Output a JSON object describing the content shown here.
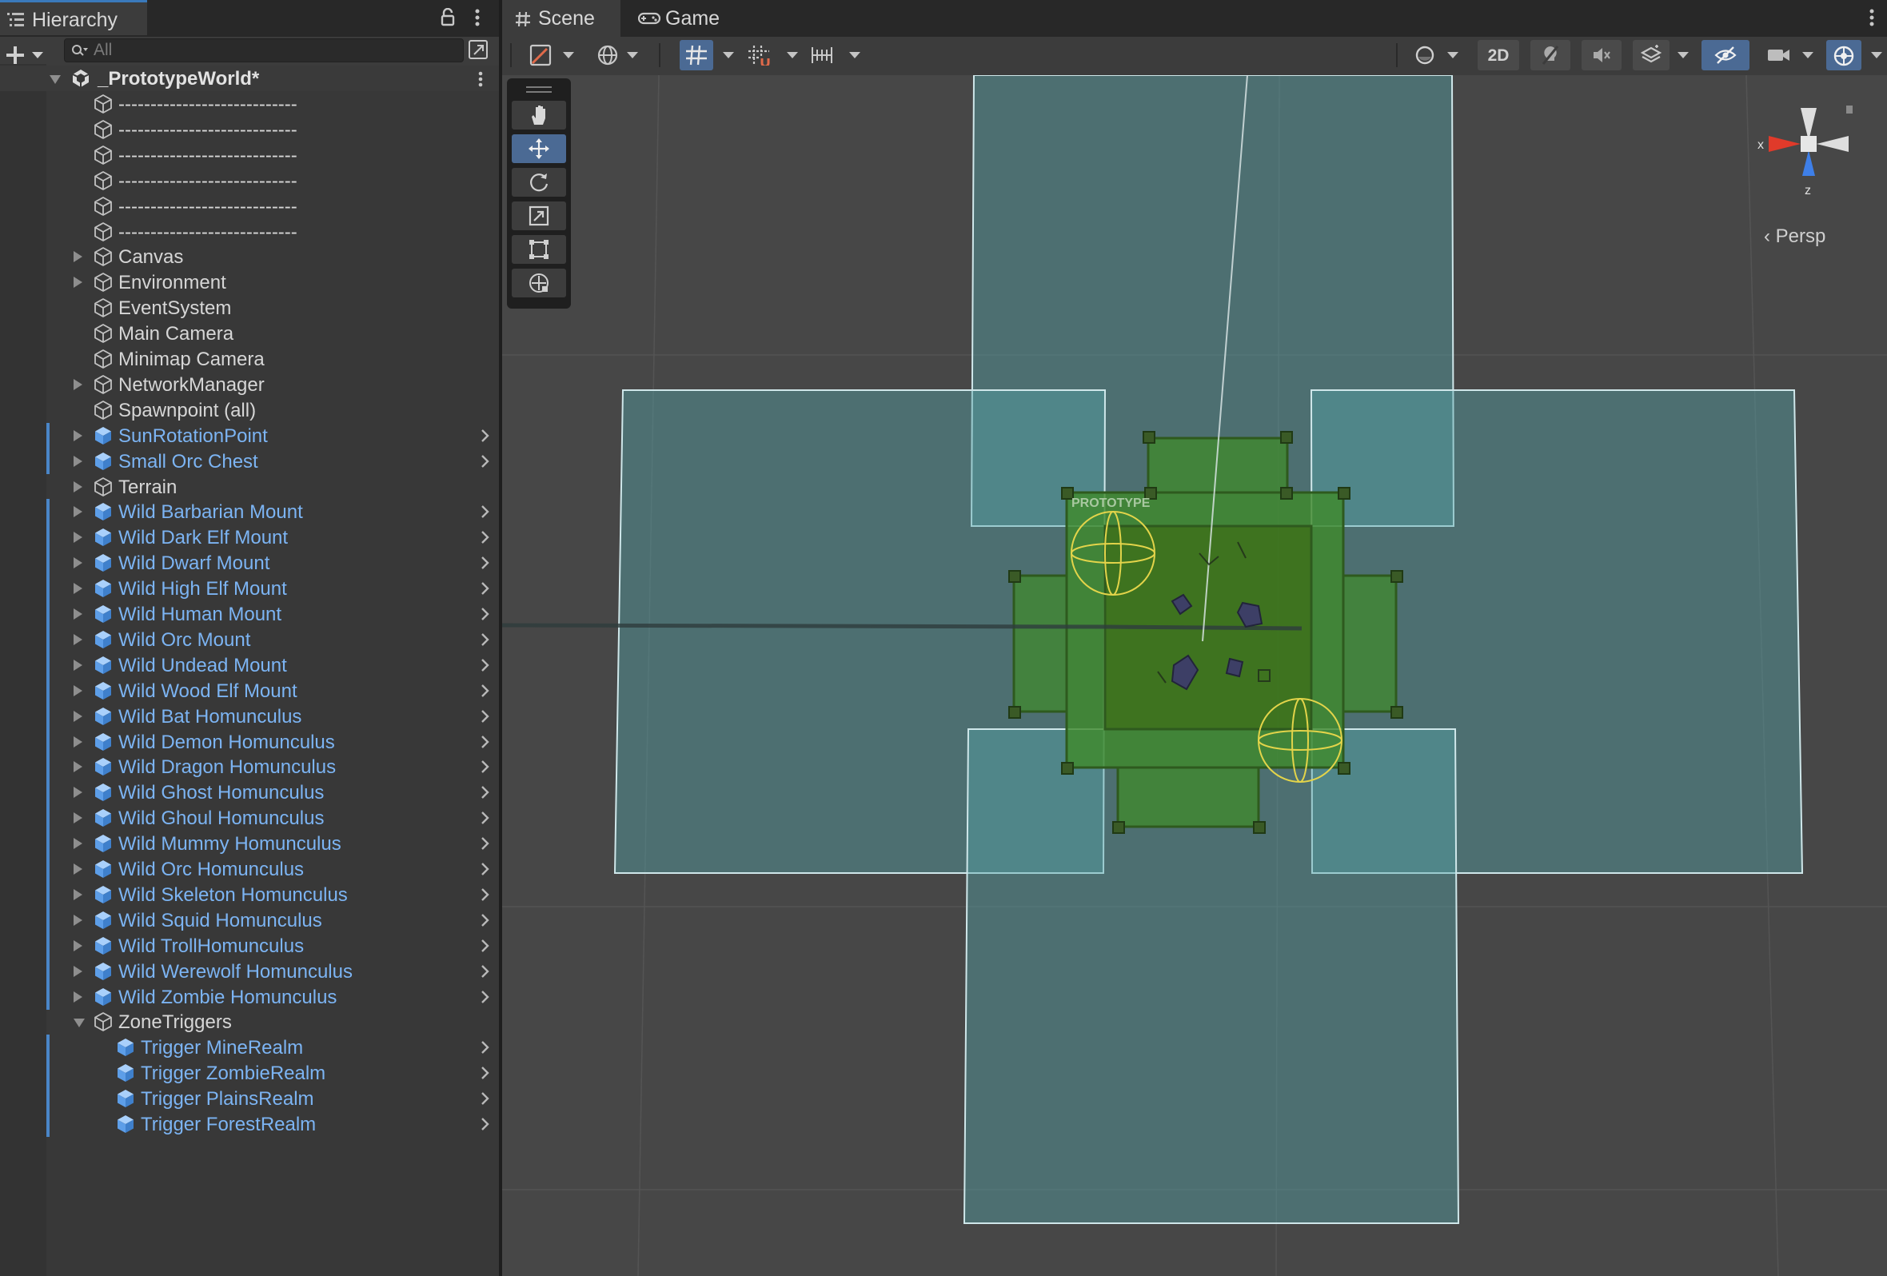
{
  "hierarchy": {
    "tab_title": "Hierarchy",
    "search_placeholder": "All",
    "scene_name": "_PrototypeWorld*",
    "rows": [
      {
        "label": "----------------------------",
        "depth": 0,
        "expander": "none",
        "prefab": false
      },
      {
        "label": "----------------------------",
        "depth": 0,
        "expander": "none",
        "prefab": false
      },
      {
        "label": "----------------------------",
        "depth": 0,
        "expander": "none",
        "prefab": false
      },
      {
        "label": "----------------------------",
        "depth": 0,
        "expander": "none",
        "prefab": false
      },
      {
        "label": "----------------------------",
        "depth": 0,
        "expander": "none",
        "prefab": false
      },
      {
        "label": "----------------------------",
        "depth": 0,
        "expander": "none",
        "prefab": false
      },
      {
        "label": "Canvas",
        "depth": 0,
        "expander": "closed",
        "prefab": false
      },
      {
        "label": "Environment",
        "depth": 0,
        "expander": "closed",
        "prefab": false
      },
      {
        "label": "EventSystem",
        "depth": 0,
        "expander": "none",
        "prefab": false
      },
      {
        "label": "Main Camera",
        "depth": 0,
        "expander": "none",
        "prefab": false
      },
      {
        "label": "Minimap Camera",
        "depth": 0,
        "expander": "none",
        "prefab": false
      },
      {
        "label": "NetworkManager",
        "depth": 0,
        "expander": "closed",
        "prefab": false
      },
      {
        "label": "Spawnpoint (all)",
        "depth": 0,
        "expander": "none",
        "prefab": false
      },
      {
        "label": "SunRotationPoint",
        "depth": 0,
        "expander": "closed",
        "prefab": true
      },
      {
        "label": "Small Orc Chest",
        "depth": 0,
        "expander": "closed",
        "prefab": true
      },
      {
        "label": "Terrain",
        "depth": 0,
        "expander": "closed",
        "prefab": false
      },
      {
        "label": "Wild Barbarian Mount",
        "depth": 0,
        "expander": "closed",
        "prefab": true
      },
      {
        "label": "Wild Dark Elf Mount",
        "depth": 0,
        "expander": "closed",
        "prefab": true
      },
      {
        "label": "Wild Dwarf Mount",
        "depth": 0,
        "expander": "closed",
        "prefab": true
      },
      {
        "label": "Wild High Elf Mount",
        "depth": 0,
        "expander": "closed",
        "prefab": true
      },
      {
        "label": "Wild Human Mount",
        "depth": 0,
        "expander": "closed",
        "prefab": true
      },
      {
        "label": "Wild Orc Mount",
        "depth": 0,
        "expander": "closed",
        "prefab": true
      },
      {
        "label": "Wild Undead Mount",
        "depth": 0,
        "expander": "closed",
        "prefab": true
      },
      {
        "label": "Wild Wood Elf Mount",
        "depth": 0,
        "expander": "closed",
        "prefab": true
      },
      {
        "label": "Wild Bat Homunculus",
        "depth": 0,
        "expander": "closed",
        "prefab": true
      },
      {
        "label": "Wild Demon Homunculus",
        "depth": 0,
        "expander": "closed",
        "prefab": true
      },
      {
        "label": "Wild Dragon Homunculus",
        "depth": 0,
        "expander": "closed",
        "prefab": true
      },
      {
        "label": "Wild Ghost Homunculus",
        "depth": 0,
        "expander": "closed",
        "prefab": true
      },
      {
        "label": "Wild Ghoul Homunculus",
        "depth": 0,
        "expander": "closed",
        "prefab": true
      },
      {
        "label": "Wild Mummy Homunculus",
        "depth": 0,
        "expander": "closed",
        "prefab": true
      },
      {
        "label": "Wild Orc Homunculus",
        "depth": 0,
        "expander": "closed",
        "prefab": true
      },
      {
        "label": "Wild Skeleton Homunculus",
        "depth": 0,
        "expander": "closed",
        "prefab": true
      },
      {
        "label": "Wild Squid Homunculus",
        "depth": 0,
        "expander": "closed",
        "prefab": true
      },
      {
        "label": "Wild TrollHomunculus",
        "depth": 0,
        "expander": "closed",
        "prefab": true
      },
      {
        "label": "Wild Werewolf Homunculus",
        "depth": 0,
        "expander": "closed",
        "prefab": true
      },
      {
        "label": "Wild Zombie Homunculus",
        "depth": 0,
        "expander": "closed",
        "prefab": true
      },
      {
        "label": "ZoneTriggers",
        "depth": 0,
        "expander": "open",
        "prefab": false
      },
      {
        "label": "Trigger MineRealm",
        "depth": 1,
        "expander": "none",
        "prefab": true
      },
      {
        "label": "Trigger ZombieRealm",
        "depth": 1,
        "expander": "none",
        "prefab": true
      },
      {
        "label": "Trigger PlainsRealm",
        "depth": 1,
        "expander": "none",
        "prefab": true
      },
      {
        "label": "Trigger ForestRealm",
        "depth": 1,
        "expander": "none",
        "prefab": true
      }
    ]
  },
  "scene_view": {
    "tab_scene": "Scene",
    "tab_game": "Game",
    "btn_2d": "2D",
    "projection_label": "Persp",
    "axis_x": "x",
    "axis_z": "z",
    "prototype_label": "PROTOTYPE"
  },
  "colors": {
    "prefab_text": "#7cb4f3",
    "accent": "#3a79bb",
    "trigger_volume": "#56a6ab",
    "ground": "#3f8a2a"
  },
  "icons": [
    "hierarchy-list-icon",
    "lock-icon",
    "kebab-menu-icon",
    "plus-icon",
    "search-icon",
    "gameobject-cube-icon",
    "prefab-cube-icon",
    "unity-scene-icon",
    "grid-hash-icon",
    "gamepad-icon",
    "hand-tool-icon",
    "move-tool-icon",
    "rotate-tool-icon",
    "scale-tool-icon",
    "rect-tool-icon",
    "transform-tool-icon",
    "scene-gizmo"
  ]
}
